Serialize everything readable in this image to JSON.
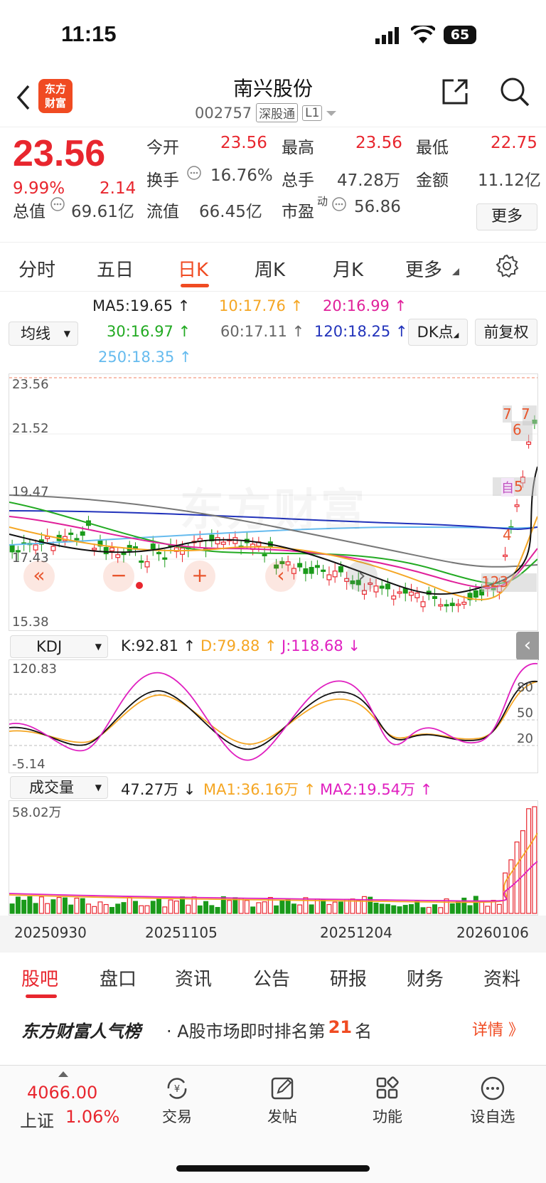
{
  "status": {
    "time": "11:15",
    "battery": "65"
  },
  "header": {
    "logo_line1": "东方",
    "logo_line2": "财富",
    "name": "南兴股份",
    "code": "002757",
    "channel": "深股通",
    "level": "L1"
  },
  "quote": {
    "price": "23.56",
    "pct": "9.99%",
    "change": "2.14",
    "open_label": "今开",
    "open": "23.56",
    "high_label": "最高",
    "high": "23.56",
    "low_label": "最低",
    "low": "22.75",
    "turnover_label": "换手",
    "turnover": "16.76%",
    "volume_label": "总手",
    "volume": "47.28万",
    "amount_label": "金额",
    "amount": "11.12亿",
    "mktcap_label": "总值",
    "mktcap": "69.61亿",
    "float_label": "流值",
    "float": "66.45亿",
    "pe_label": "市盈",
    "pe_sup": "动",
    "pe": "56.86",
    "more": "更多"
  },
  "tabs": [
    "分时",
    "五日",
    "日K",
    "周K",
    "月K",
    "更多"
  ],
  "ma": {
    "selector": "均线",
    "ma5": "MA5:19.65 ↑",
    "ma10": "10:17.76 ↑",
    "ma20": "20:16.99 ↑",
    "ma30": "30:16.97 ↑",
    "ma60": "60:17.11 ↑",
    "ma120": "120:18.25 ↑",
    "ma250": "250:18.35 ↑",
    "dk": "DK点",
    "adjust": "前复权",
    "colors": {
      "ma5": "#111111",
      "ma10": "#f5a623",
      "ma20": "#e0209a",
      "ma30": "#22aa22",
      "ma60": "#777777",
      "ma120": "#2233bb",
      "ma250": "#66bbee"
    }
  },
  "kline": {
    "y_labels": [
      "23.56",
      "21.52",
      "19.47",
      "17.43",
      "15.38"
    ],
    "markers": [
      "自",
      "5",
      "6",
      "7",
      "4",
      "123"
    ],
    "watermark": "东方财富"
  },
  "kdj": {
    "selector": "KDJ",
    "k": "K:92.81 ↑",
    "d": "D:79.88 ↑",
    "j": "J:118.68 ↓",
    "y_top": "120.83",
    "y_bottom": "-5.14",
    "levels": [
      "80",
      "50",
      "20"
    ]
  },
  "vol": {
    "selector": "成交量",
    "v": "47.27万 ↓",
    "ma1": "MA1:36.16万 ↑",
    "ma2": "MA2:19.54万 ↑",
    "y_top": "58.02万"
  },
  "dates": [
    "20250930",
    "20251105",
    "20251204",
    "20260106"
  ],
  "bottom_tabs": [
    "股吧",
    "盘口",
    "资讯",
    "公告",
    "研报",
    "财务",
    "资料"
  ],
  "rank": {
    "brand": "东方财富人气榜",
    "text_prefix": "· A股市场即时排名第",
    "rank": "21",
    "text_suffix": "名",
    "detail": "详情 》"
  },
  "dock": {
    "index_value": "4066.00",
    "index_name": "上证",
    "index_pct": "1.06%",
    "items": [
      "交易",
      "发帖",
      "功能",
      "设自选"
    ]
  }
}
